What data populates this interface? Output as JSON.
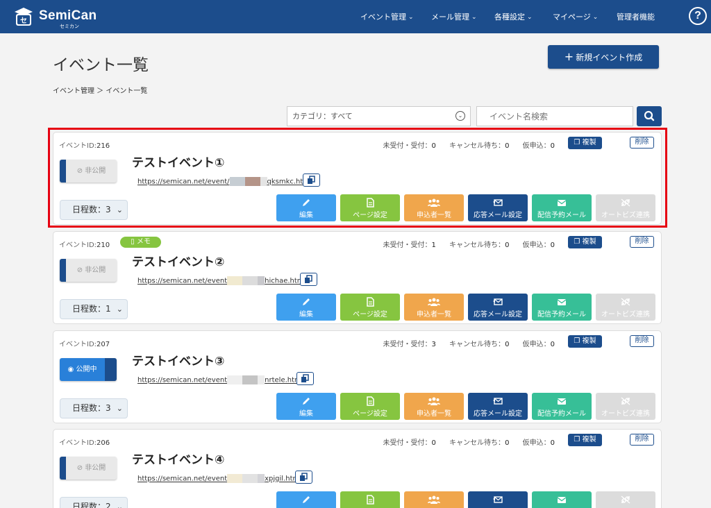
{
  "app": {
    "name": "SemiCan",
    "sub": "セミカン"
  },
  "nav": [
    {
      "label": "イベント管理",
      "chevron": true
    },
    {
      "label": "メール管理",
      "chevron": true
    },
    {
      "label": "各種設定",
      "chevron": true
    },
    {
      "label": "マイページ",
      "chevron": true
    },
    {
      "label": "管理者機能",
      "chevron": false
    }
  ],
  "help_label": "?",
  "page": {
    "title": "イベント一覧",
    "new_button": "新規イベント作成",
    "breadcrumb": "イベント管理 ＞ イベント一覧"
  },
  "filter": {
    "category_value": "カテゴリ：すべて",
    "search_placeholder": "イベント名検索"
  },
  "labels": {
    "event_id_prefix": "イベントID:",
    "unaccepted_accepted": "未受付・受付：",
    "cancel_wait": "キャンセル待ち：",
    "temp_apply": "仮申込：",
    "copy": "複製",
    "delete": "削除",
    "days_prefix": "日程数：",
    "memo": "メモ",
    "private": "非公開",
    "public": "公開中",
    "actions": {
      "edit": "編集",
      "page_settings": "ページ設定",
      "applicants": "申込者一覧",
      "reply_mail": "応答メール設定",
      "scheduled_mail": "配信予約メール",
      "autobiz": "オートビズ連携"
    }
  },
  "events": [
    {
      "id": "216",
      "memo": false,
      "accepted": "0",
      "cancel_wait": "0",
      "temp": "0",
      "status": "private",
      "title": "テストイベント①",
      "url_start": "https://semican.net/event/",
      "url_end": "qksmkc.html",
      "days": "3"
    },
    {
      "id": "210",
      "memo": true,
      "accepted": "1",
      "cancel_wait": "0",
      "temp": "0",
      "status": "private",
      "title": "テストイベント②",
      "url_start": "https://semican.net/event",
      "url_end": "hichae.html",
      "days": "1"
    },
    {
      "id": "207",
      "memo": false,
      "accepted": "3",
      "cancel_wait": "0",
      "temp": "0",
      "status": "public",
      "title": "テストイベント③",
      "url_start": "https://semican.net/event",
      "url_end": "nrtele.html",
      "days": "3"
    },
    {
      "id": "206",
      "memo": false,
      "accepted": "0",
      "cancel_wait": "0",
      "temp": "0",
      "status": "private",
      "title": "テストイベント④",
      "url_start": "https://semican.net/event",
      "url_end": "xpjgil.html",
      "days": "2"
    }
  ],
  "colors": {
    "brand": "#1c4d8c",
    "edit": "#3fa0ef",
    "page": "#86c540",
    "applicants": "#f0a64c",
    "scheduled": "#37bf97",
    "highlight": "#e60012"
  }
}
